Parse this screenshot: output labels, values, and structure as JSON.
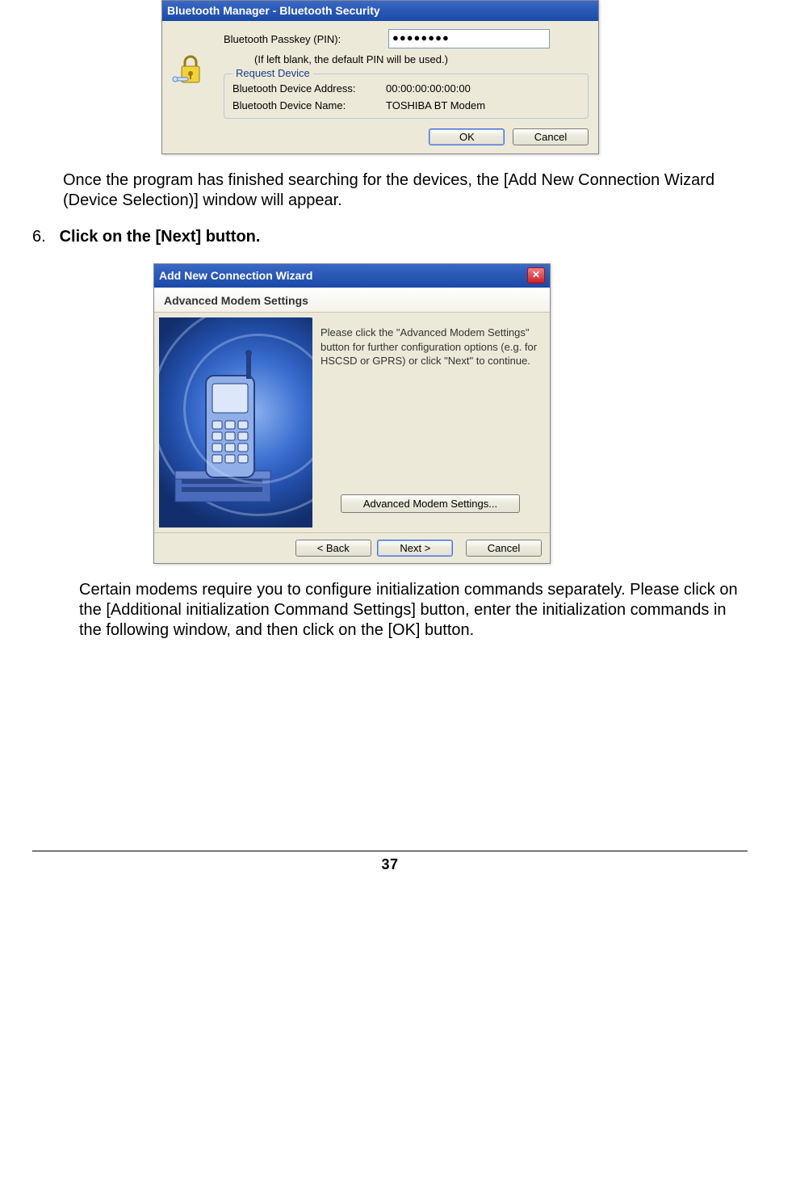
{
  "dlg1": {
    "title": "Bluetooth Manager - Bluetooth Security",
    "pin_label": "Bluetooth Passkey (PIN):",
    "pin_value": "●●●●●●●●",
    "hint": "(If left blank, the default PIN will be used.)",
    "group_title": "Request Device",
    "addr_label": "Bluetooth Device Address:",
    "addr_value": "00:00:00:00:00:00",
    "name_label": "Bluetooth Device Name:",
    "name_value": "TOSHIBA BT Modem",
    "ok": "OK",
    "cancel": "Cancel"
  },
  "para1": "Once the program has finished searching for the devices, the [Add New Connection Wizard (Device Selection)] window will appear.",
  "step6": {
    "num": "6.",
    "text": "Click on the [Next] button."
  },
  "dlg2": {
    "title": "Add New Connection Wizard",
    "header": "Advanced Modem Settings",
    "desc": "Please click the \"Advanced Modem Settings\" button for further configuration options (e.g. for HSCSD or GPRS) or click \"Next\" to continue.",
    "adv_btn": "Advanced Modem Settings...",
    "back": "< Back",
    "next": "Next >",
    "cancel": "Cancel"
  },
  "para2": "Certain modems require you to configure initialization commands separately. Please click on the [Additional initialization Command Settings] button, enter the initialization commands in the following window, and then click on the [OK] button.",
  "page_number": "37"
}
